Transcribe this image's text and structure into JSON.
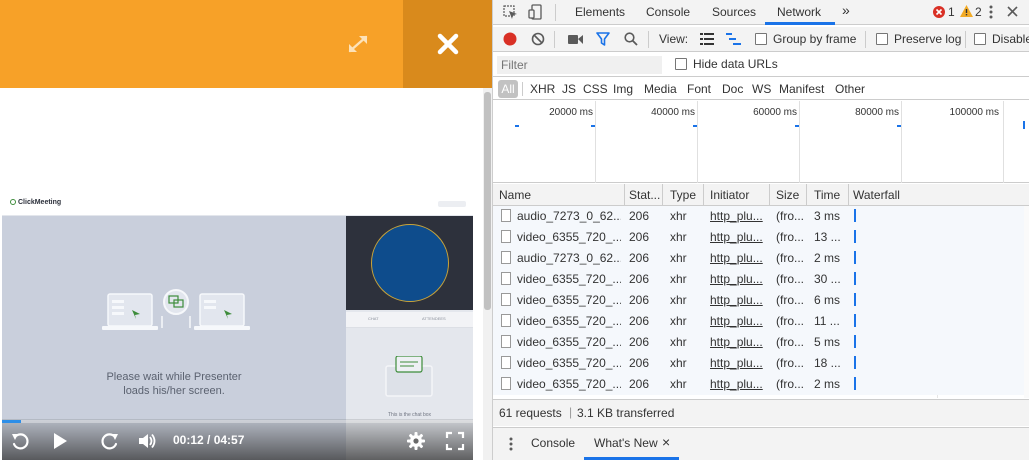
{
  "player": {
    "brand": "ClickMeeting",
    "wait_message": "Please wait while Presenter loads his/her screen.",
    "chat_tab": "CHAT",
    "attendees_tab": "ATTENDEES",
    "chat_placeholder": "This is the chat box",
    "time": "00:12 / 04:57",
    "progress": 0.04,
    "colors": {
      "orange": "#f7a128",
      "orange_dark": "#d98a1c",
      "progress": "#2d8ee8",
      "video_circle": "#0e4c8c"
    }
  },
  "devtools": {
    "tabs": [
      "Elements",
      "Console",
      "Sources",
      "Network"
    ],
    "active_tab": "Network",
    "more_tabs_glyph": "»",
    "errors": "1",
    "warnings": "2",
    "toolbar": {
      "view_label": "View:",
      "group_by_frame": "Group by frame",
      "preserve_log": "Preserve log",
      "disable_cache": "Disable"
    },
    "filter": {
      "placeholder": "Filter",
      "hide_data_urls": "Hide data URLs"
    },
    "types": [
      "All",
      "XHR",
      "JS",
      "CSS",
      "Img",
      "Media",
      "Font",
      "Doc",
      "WS",
      "Manifest",
      "Other"
    ],
    "overview_ticks": [
      "20000 ms",
      "40000 ms",
      "60000 ms",
      "80000 ms",
      "100000 ms"
    ],
    "columns": [
      "Name",
      "Stat...",
      "Type",
      "Initiator",
      "Size",
      "Time",
      "Waterfall"
    ],
    "rows": [
      {
        "name": "audio_7273_0_62....",
        "status": "206",
        "type": "xhr",
        "initiator": "http_plu...",
        "size": "(fro...",
        "time": "3 ms"
      },
      {
        "name": "video_6355_720_...",
        "status": "206",
        "type": "xhr",
        "initiator": "http_plu...",
        "size": "(fro...",
        "time": "13 ..."
      },
      {
        "name": "audio_7273_0_62....",
        "status": "206",
        "type": "xhr",
        "initiator": "http_plu...",
        "size": "(fro...",
        "time": "2 ms"
      },
      {
        "name": "video_6355_720_...",
        "status": "206",
        "type": "xhr",
        "initiator": "http_plu...",
        "size": "(fro...",
        "time": "30 ..."
      },
      {
        "name": "video_6355_720_...",
        "status": "206",
        "type": "xhr",
        "initiator": "http_plu...",
        "size": "(fro...",
        "time": "6 ms"
      },
      {
        "name": "video_6355_720_...",
        "status": "206",
        "type": "xhr",
        "initiator": "http_plu...",
        "size": "(fro...",
        "time": "11 ..."
      },
      {
        "name": "video_6355_720_...",
        "status": "206",
        "type": "xhr",
        "initiator": "http_plu...",
        "size": "(fro...",
        "time": "5 ms"
      },
      {
        "name": "video_6355_720_...",
        "status": "206",
        "type": "xhr",
        "initiator": "http_plu...",
        "size": "(fro...",
        "time": "18 ..."
      },
      {
        "name": "video_6355_720_...",
        "status": "206",
        "type": "xhr",
        "initiator": "http_plu...",
        "size": "(fro...",
        "time": "2 ms"
      }
    ],
    "status": {
      "requests": "61 requests",
      "separator": "|",
      "transferred": "3.1 KB transferred"
    },
    "drawer": {
      "tabs": [
        "Console",
        "What's New"
      ],
      "close_glyph": "×"
    }
  }
}
